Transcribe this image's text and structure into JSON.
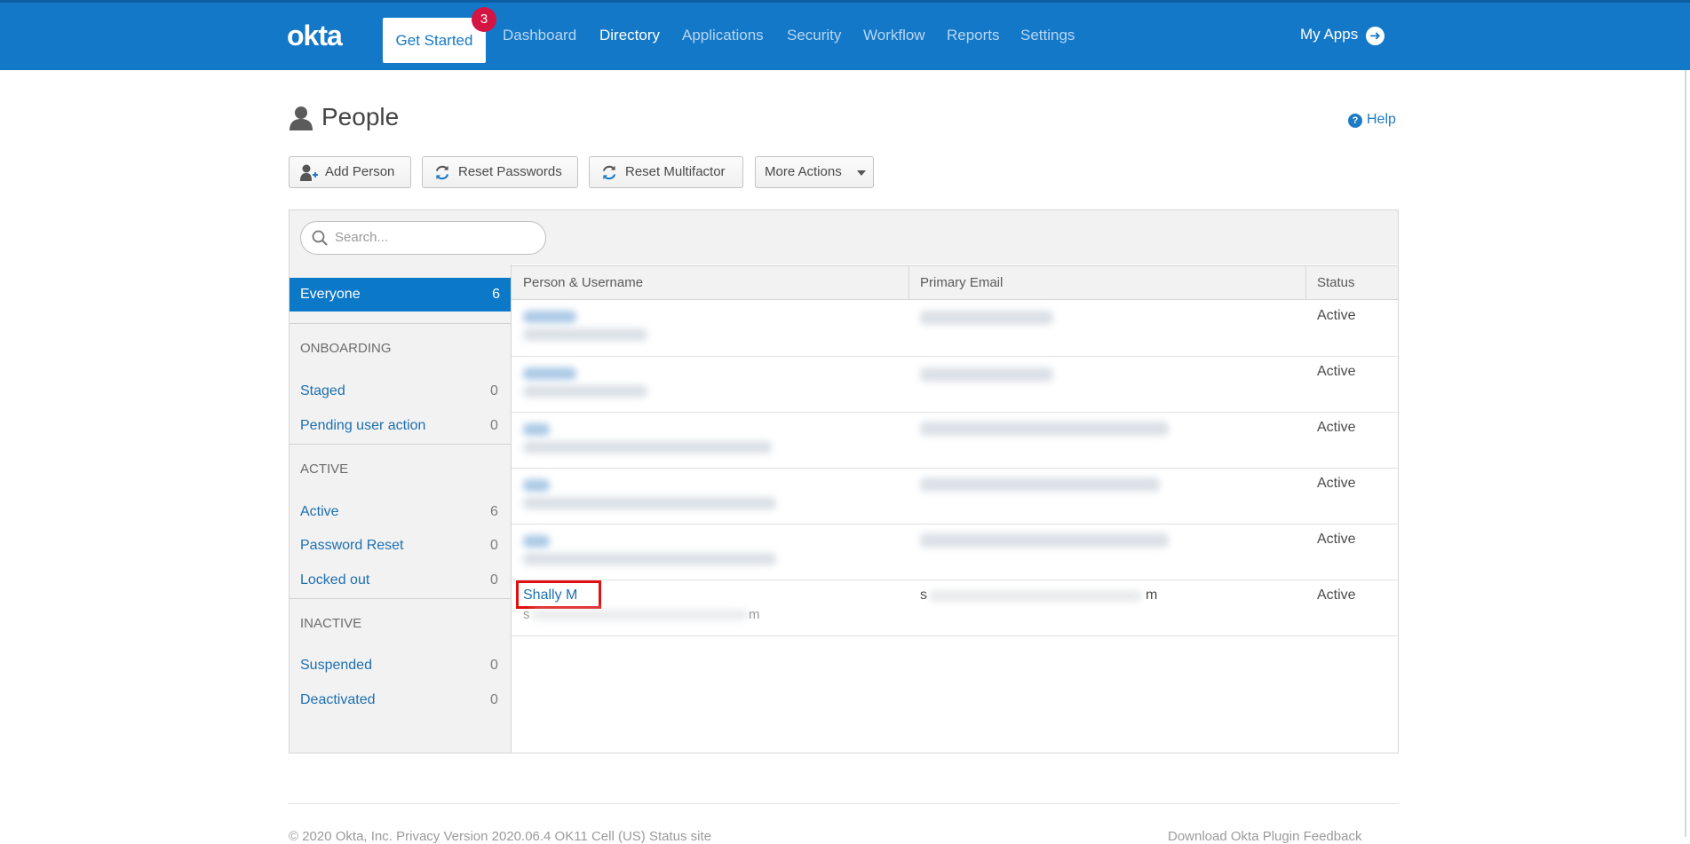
{
  "nav": {
    "logo": "okta",
    "get_started": "Get Started",
    "badge_count": "3",
    "items": [
      "Dashboard",
      "Directory",
      "Applications",
      "Security",
      "Workflow",
      "Reports",
      "Settings"
    ],
    "active_item": "Directory",
    "my_apps": "My Apps"
  },
  "header": {
    "title": "People",
    "help": "Help"
  },
  "actions": {
    "add_person": "Add Person",
    "reset_passwords": "Reset Passwords",
    "reset_multifactor": "Reset Multifactor",
    "more_actions": "More Actions"
  },
  "search": {
    "placeholder": "Search..."
  },
  "sidebar": {
    "everyone": {
      "label": "Everyone",
      "count": "6"
    },
    "onboarding_heading": "ONBOARDING",
    "staged": {
      "label": "Staged",
      "count": "0"
    },
    "pending": {
      "label": "Pending user action",
      "count": "0"
    },
    "active_heading": "ACTIVE",
    "active": {
      "label": "Active",
      "count": "6"
    },
    "password_reset": {
      "label": "Password Reset",
      "count": "0"
    },
    "locked_out": {
      "label": "Locked out",
      "count": "0"
    },
    "inactive_heading": "INACTIVE",
    "suspended": {
      "label": "Suspended",
      "count": "0"
    },
    "deactivated": {
      "label": "Deactivated",
      "count": "0"
    }
  },
  "table": {
    "headers": [
      "Person & Username",
      "Primary Email",
      "Status"
    ],
    "rows": [
      {
        "status": "Active"
      },
      {
        "status": "Active"
      },
      {
        "status": "Active"
      },
      {
        "status": "Active"
      },
      {
        "status": "Active"
      },
      {
        "name": "Shally M",
        "username_partial": "s",
        "username_end": "m",
        "email_start": "s",
        "email_end": "m",
        "status": "Active"
      }
    ]
  },
  "footer": {
    "left": "© 2020 Okta, Inc.   Privacy     Version 2020.06.4     OK11 Cell (US)     Status site",
    "right": "Download Okta Plugin     Feedback"
  }
}
